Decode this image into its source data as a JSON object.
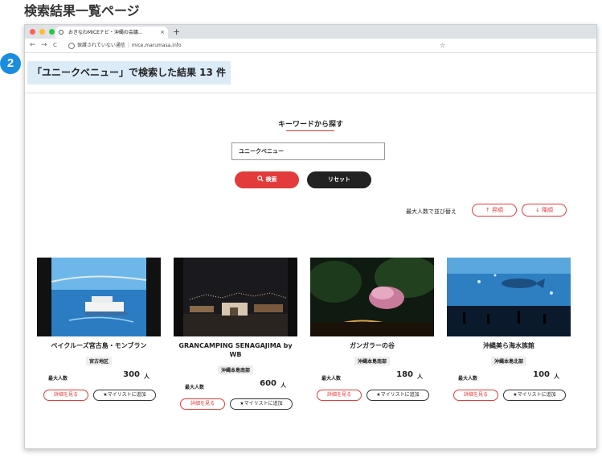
{
  "page": {
    "heading": "検索結果一覧ページ",
    "step_badge": "2"
  },
  "browser": {
    "tab_title": "おきなわMICEナビ・沖縄の会議...",
    "tab_close": "×",
    "new_tab": "+",
    "security_label": "保護されていない通信",
    "url": "mice.marumasa.info",
    "nav_back": "←",
    "nav_forward": "→",
    "nav_reload": "C",
    "bookmark_star": "☆"
  },
  "results": {
    "summary": "「ユニークベニュー」で検索した結果 13 件"
  },
  "search": {
    "title": "キーワードから探す",
    "input_value": "ユニークベニュー",
    "search_button": "検索",
    "reset_button": "リセット"
  },
  "sort": {
    "label": "最大人数で並び替え",
    "asc": "昇順",
    "desc": "降順"
  },
  "cards": [
    {
      "title": "ベイクルーズ宮古島・モンブラン",
      "region": "宮古地区",
      "capacity_label": "最大人数",
      "capacity": "300",
      "unit": "人",
      "detail": "詳細を見る",
      "mylist": "★マイリストに追加"
    },
    {
      "title": "GRANCAMPING SENAGAJIMA by WB",
      "region": "沖縄本島南部",
      "capacity_label": "最大人数",
      "capacity": "600",
      "unit": "人",
      "detail": "詳細を見る",
      "mylist": "★マイリストに追加"
    },
    {
      "title": "ガンガラーの谷",
      "region": "沖縄本島南部",
      "capacity_label": "最大人数",
      "capacity": "180",
      "unit": "人",
      "detail": "詳細を見る",
      "mylist": "★マイリストに追加"
    },
    {
      "title": "沖縄美ら海水族館",
      "region": "沖縄本島北部",
      "capacity_label": "最大人数",
      "capacity": "100",
      "unit": "人",
      "detail": "詳細を見る",
      "mylist": "★マイリストに追加"
    }
  ],
  "colors": {
    "accent_red": "#e33b3b",
    "badge_blue": "#1a8de0",
    "highlight": "#dcebf8"
  }
}
